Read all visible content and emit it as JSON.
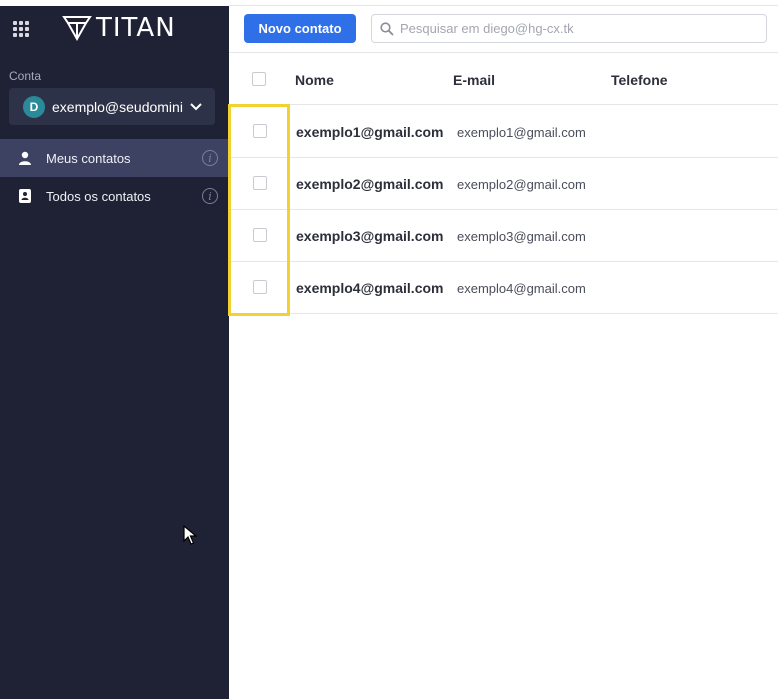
{
  "sidebar": {
    "logo_text": "TITAN",
    "account_label": "Conta",
    "account_avatar_letter": "D",
    "account_email": "exemplo@seudomini...",
    "nav": [
      {
        "label": "Meus contatos",
        "icon": "user-icon",
        "active": true
      },
      {
        "label": "Todos os contatos",
        "icon": "contacts-book-icon",
        "active": false
      }
    ]
  },
  "toolbar": {
    "new_contact_label": "Novo contato",
    "search_placeholder": "Pesquisar em diego@hg-cx.tk"
  },
  "table": {
    "headers": {
      "name": "Nome",
      "email": "E-mail",
      "phone": "Telefone"
    },
    "rows": [
      {
        "name": "exemplo1@gmail.com",
        "email": "exemplo1@gmail.com",
        "phone": ""
      },
      {
        "name": "exemplo2@gmail.com",
        "email": "exemplo2@gmail.com",
        "phone": ""
      },
      {
        "name": "exemplo3@gmail.com",
        "email": "exemplo3@gmail.com",
        "phone": ""
      },
      {
        "name": "exemplo4@gmail.com",
        "email": "exemplo4@gmail.com",
        "phone": ""
      }
    ]
  },
  "colors": {
    "sidebar_bg": "#1f2235",
    "accent": "#2f6fe8",
    "highlight": "#f2d230"
  }
}
